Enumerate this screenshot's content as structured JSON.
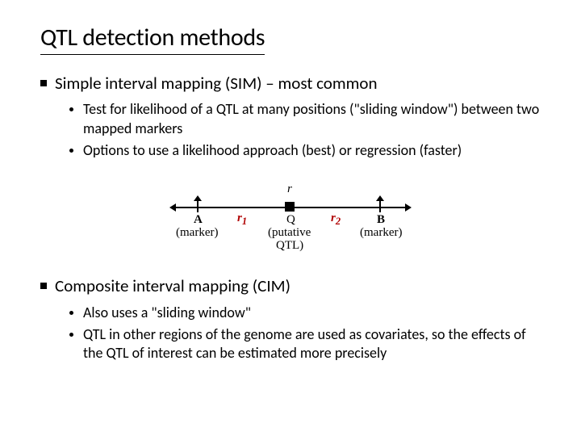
{
  "title": "QTL detection methods",
  "sections": [
    {
      "heading": "Simple interval mapping (SIM) – most common",
      "subs": [
        "Test for likelihood of a QTL at many positions (\"sliding window\") between two mapped markers",
        "Options to use a likelihood approach (best) or regression (faster)"
      ]
    },
    {
      "heading": "Composite interval mapping (CIM)",
      "subs": [
        "Also uses a \"sliding window\"",
        "QTL in other regions of the genome are used as covariates, so the effects of the QTL of interest can be estimated more precisely"
      ]
    }
  ],
  "diagram": {
    "r": "r",
    "r1": "r",
    "r1sub": "1",
    "r2": "r",
    "r2sub": "2",
    "A": "A",
    "B": "B",
    "Q": "Q",
    "markerA": "(marker)",
    "markerB": "(marker)",
    "putative": "(putative",
    "qtl": "QTL)"
  }
}
